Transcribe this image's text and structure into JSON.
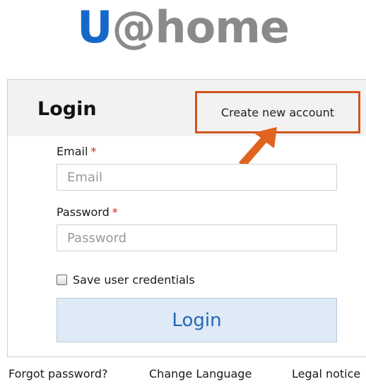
{
  "logo": {
    "u": "U",
    "at": "@",
    "home": "home",
    "colors": {
      "u": "#1668c8",
      "rest": "#8a8a8a"
    }
  },
  "panel": {
    "title": "Login",
    "create_account": "Create new account",
    "highlight_color": "#d2541c"
  },
  "form": {
    "email": {
      "label": "Email",
      "required_mark": "*",
      "value": "",
      "placeholder": "Email"
    },
    "password": {
      "label": "Password",
      "required_mark": "*",
      "value": "",
      "placeholder": "Password"
    },
    "save_credentials": {
      "label": "Save user credentials",
      "checked": false
    },
    "submit_label": "Login"
  },
  "footer": {
    "forgot": "Forgot password?",
    "language": "Change Language",
    "legal": "Legal notice"
  }
}
